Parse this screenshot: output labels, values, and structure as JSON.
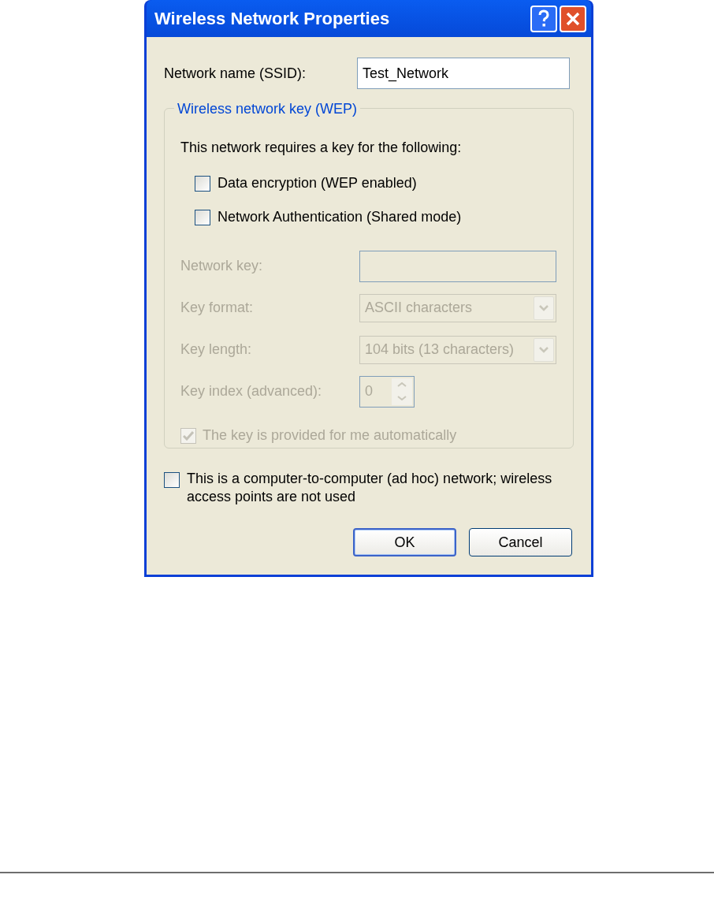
{
  "window": {
    "title": "Wireless Network Properties"
  },
  "network_name": {
    "label": "Network name (SSID):",
    "value": "Test_Network"
  },
  "wep_group": {
    "legend": "Wireless network key (WEP)",
    "intro": "This network requires a key for the following:",
    "options": [
      {
        "label": "Data encryption (WEP enabled)",
        "checked": false
      },
      {
        "label": "Network Authentication (Shared mode)",
        "checked": false
      }
    ],
    "key_fields": [
      {
        "kind": "text",
        "label": "Network key:",
        "disabled": true
      },
      {
        "kind": "combo",
        "label": "Key format:",
        "value": "ASCII characters",
        "disabled": true
      },
      {
        "kind": "combo",
        "label": "Key length:",
        "value": "104 bits (13 characters)",
        "disabled": true
      },
      {
        "kind": "spinner",
        "label": "Key index (advanced):",
        "value": "0",
        "disabled": true
      }
    ],
    "auto_key": {
      "label": "The key is provided for me automatically",
      "checked": true,
      "disabled": true
    }
  },
  "adhoc": {
    "label": "This is a computer-to-computer (ad hoc) network; wireless access points are not used",
    "checked": false
  },
  "buttons": [
    {
      "label": "OK",
      "default": true
    },
    {
      "label": "Cancel",
      "default": false
    }
  ]
}
